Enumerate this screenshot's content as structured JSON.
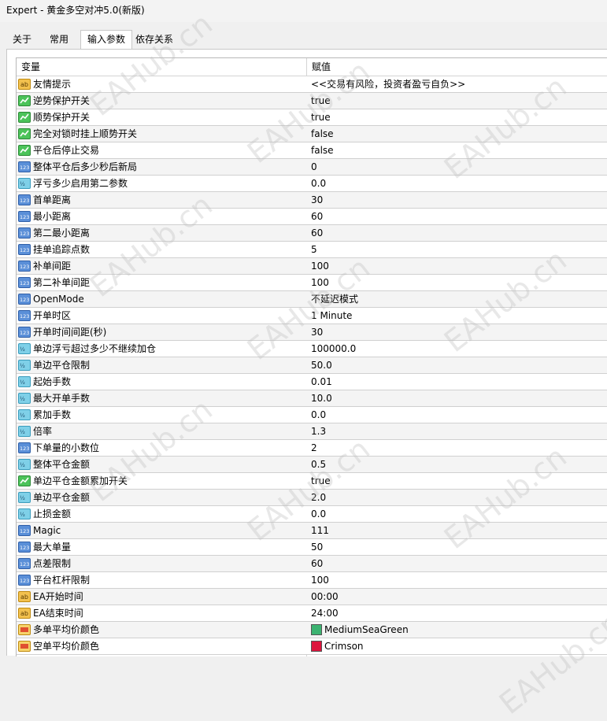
{
  "window": {
    "title": "Expert - 黄金多空对冲5.0(新版)"
  },
  "tabs": [
    {
      "label": "关于",
      "active": false
    },
    {
      "label": "常用",
      "active": false
    },
    {
      "label": "输入参数",
      "active": true
    },
    {
      "label": "依存关系",
      "active": false
    }
  ],
  "table": {
    "col_variable": "变量",
    "col_value": "赋值",
    "rows": [
      {
        "icon": "string-icon",
        "name": "友情提示",
        "value": "<<交易有风险，投资者盈亏自负>>"
      },
      {
        "icon": "bool-icon",
        "name": "逆势保护开关",
        "value": "true"
      },
      {
        "icon": "bool-icon",
        "name": "顺势保护开关",
        "value": "true"
      },
      {
        "icon": "bool-icon",
        "name": "完全对锁时挂上顺势开关",
        "value": "false"
      },
      {
        "icon": "bool-icon",
        "name": "平仓后停止交易",
        "value": "false"
      },
      {
        "icon": "int-icon",
        "name": "整体平仓后多少秒后新局",
        "value": "0"
      },
      {
        "icon": "double-icon",
        "name": "浮亏多少启用第二参数",
        "value": "0.0"
      },
      {
        "icon": "int-icon",
        "name": "首单距离",
        "value": "30"
      },
      {
        "icon": "int-icon",
        "name": "最小距离",
        "value": "60"
      },
      {
        "icon": "int-icon",
        "name": "第二最小距离",
        "value": "60"
      },
      {
        "icon": "int-icon",
        "name": "挂单追踪点数",
        "value": "5"
      },
      {
        "icon": "int-icon",
        "name": "补单间距",
        "value": "100"
      },
      {
        "icon": "int-icon",
        "name": "第二补单间距",
        "value": "100"
      },
      {
        "icon": "int-icon",
        "name": "OpenMode",
        "value": "不延迟模式"
      },
      {
        "icon": "int-icon",
        "name": "开单时区",
        "value": "1 Minute"
      },
      {
        "icon": "int-icon",
        "name": "开单时间间距(秒)",
        "value": "30"
      },
      {
        "icon": "double-icon",
        "name": "单边浮亏超过多少不继续加仓",
        "value": "100000.0"
      },
      {
        "icon": "double-icon",
        "name": "单边平仓限制",
        "value": "50.0"
      },
      {
        "icon": "double-icon",
        "name": "起始手数",
        "value": "0.01"
      },
      {
        "icon": "double-icon",
        "name": "最大开单手数",
        "value": "10.0"
      },
      {
        "icon": "double-icon",
        "name": "累加手数",
        "value": "0.0"
      },
      {
        "icon": "double-icon",
        "name": "倍率",
        "value": "1.3"
      },
      {
        "icon": "int-icon",
        "name": "下单量的小数位",
        "value": "2"
      },
      {
        "icon": "double-icon",
        "name": "整体平仓金额",
        "value": "0.5"
      },
      {
        "icon": "bool-icon",
        "name": "单边平仓金额累加开关",
        "value": "true"
      },
      {
        "icon": "double-icon",
        "name": "单边平仓金额",
        "value": "2.0"
      },
      {
        "icon": "double-icon",
        "name": "止损金额",
        "value": "0.0"
      },
      {
        "icon": "int-icon",
        "name": "Magic",
        "value": "111"
      },
      {
        "icon": "int-icon",
        "name": "最大单量",
        "value": "50"
      },
      {
        "icon": "int-icon",
        "name": "点差限制",
        "value": "60"
      },
      {
        "icon": "int-icon",
        "name": "平台杠杆限制",
        "value": "100"
      },
      {
        "icon": "string-icon",
        "name": "EA开始时间",
        "value": "00:00"
      },
      {
        "icon": "string-icon",
        "name": "EA结束时间",
        "value": "24:00"
      },
      {
        "icon": "color-icon",
        "name": "多单平均价颜色",
        "value": "MediumSeaGreen",
        "swatch": "#3cb371"
      },
      {
        "icon": "color-icon",
        "name": "空单平均价颜色",
        "value": "Crimson",
        "swatch": "#dc143c"
      }
    ]
  },
  "watermark_text": "EAHub.cn"
}
